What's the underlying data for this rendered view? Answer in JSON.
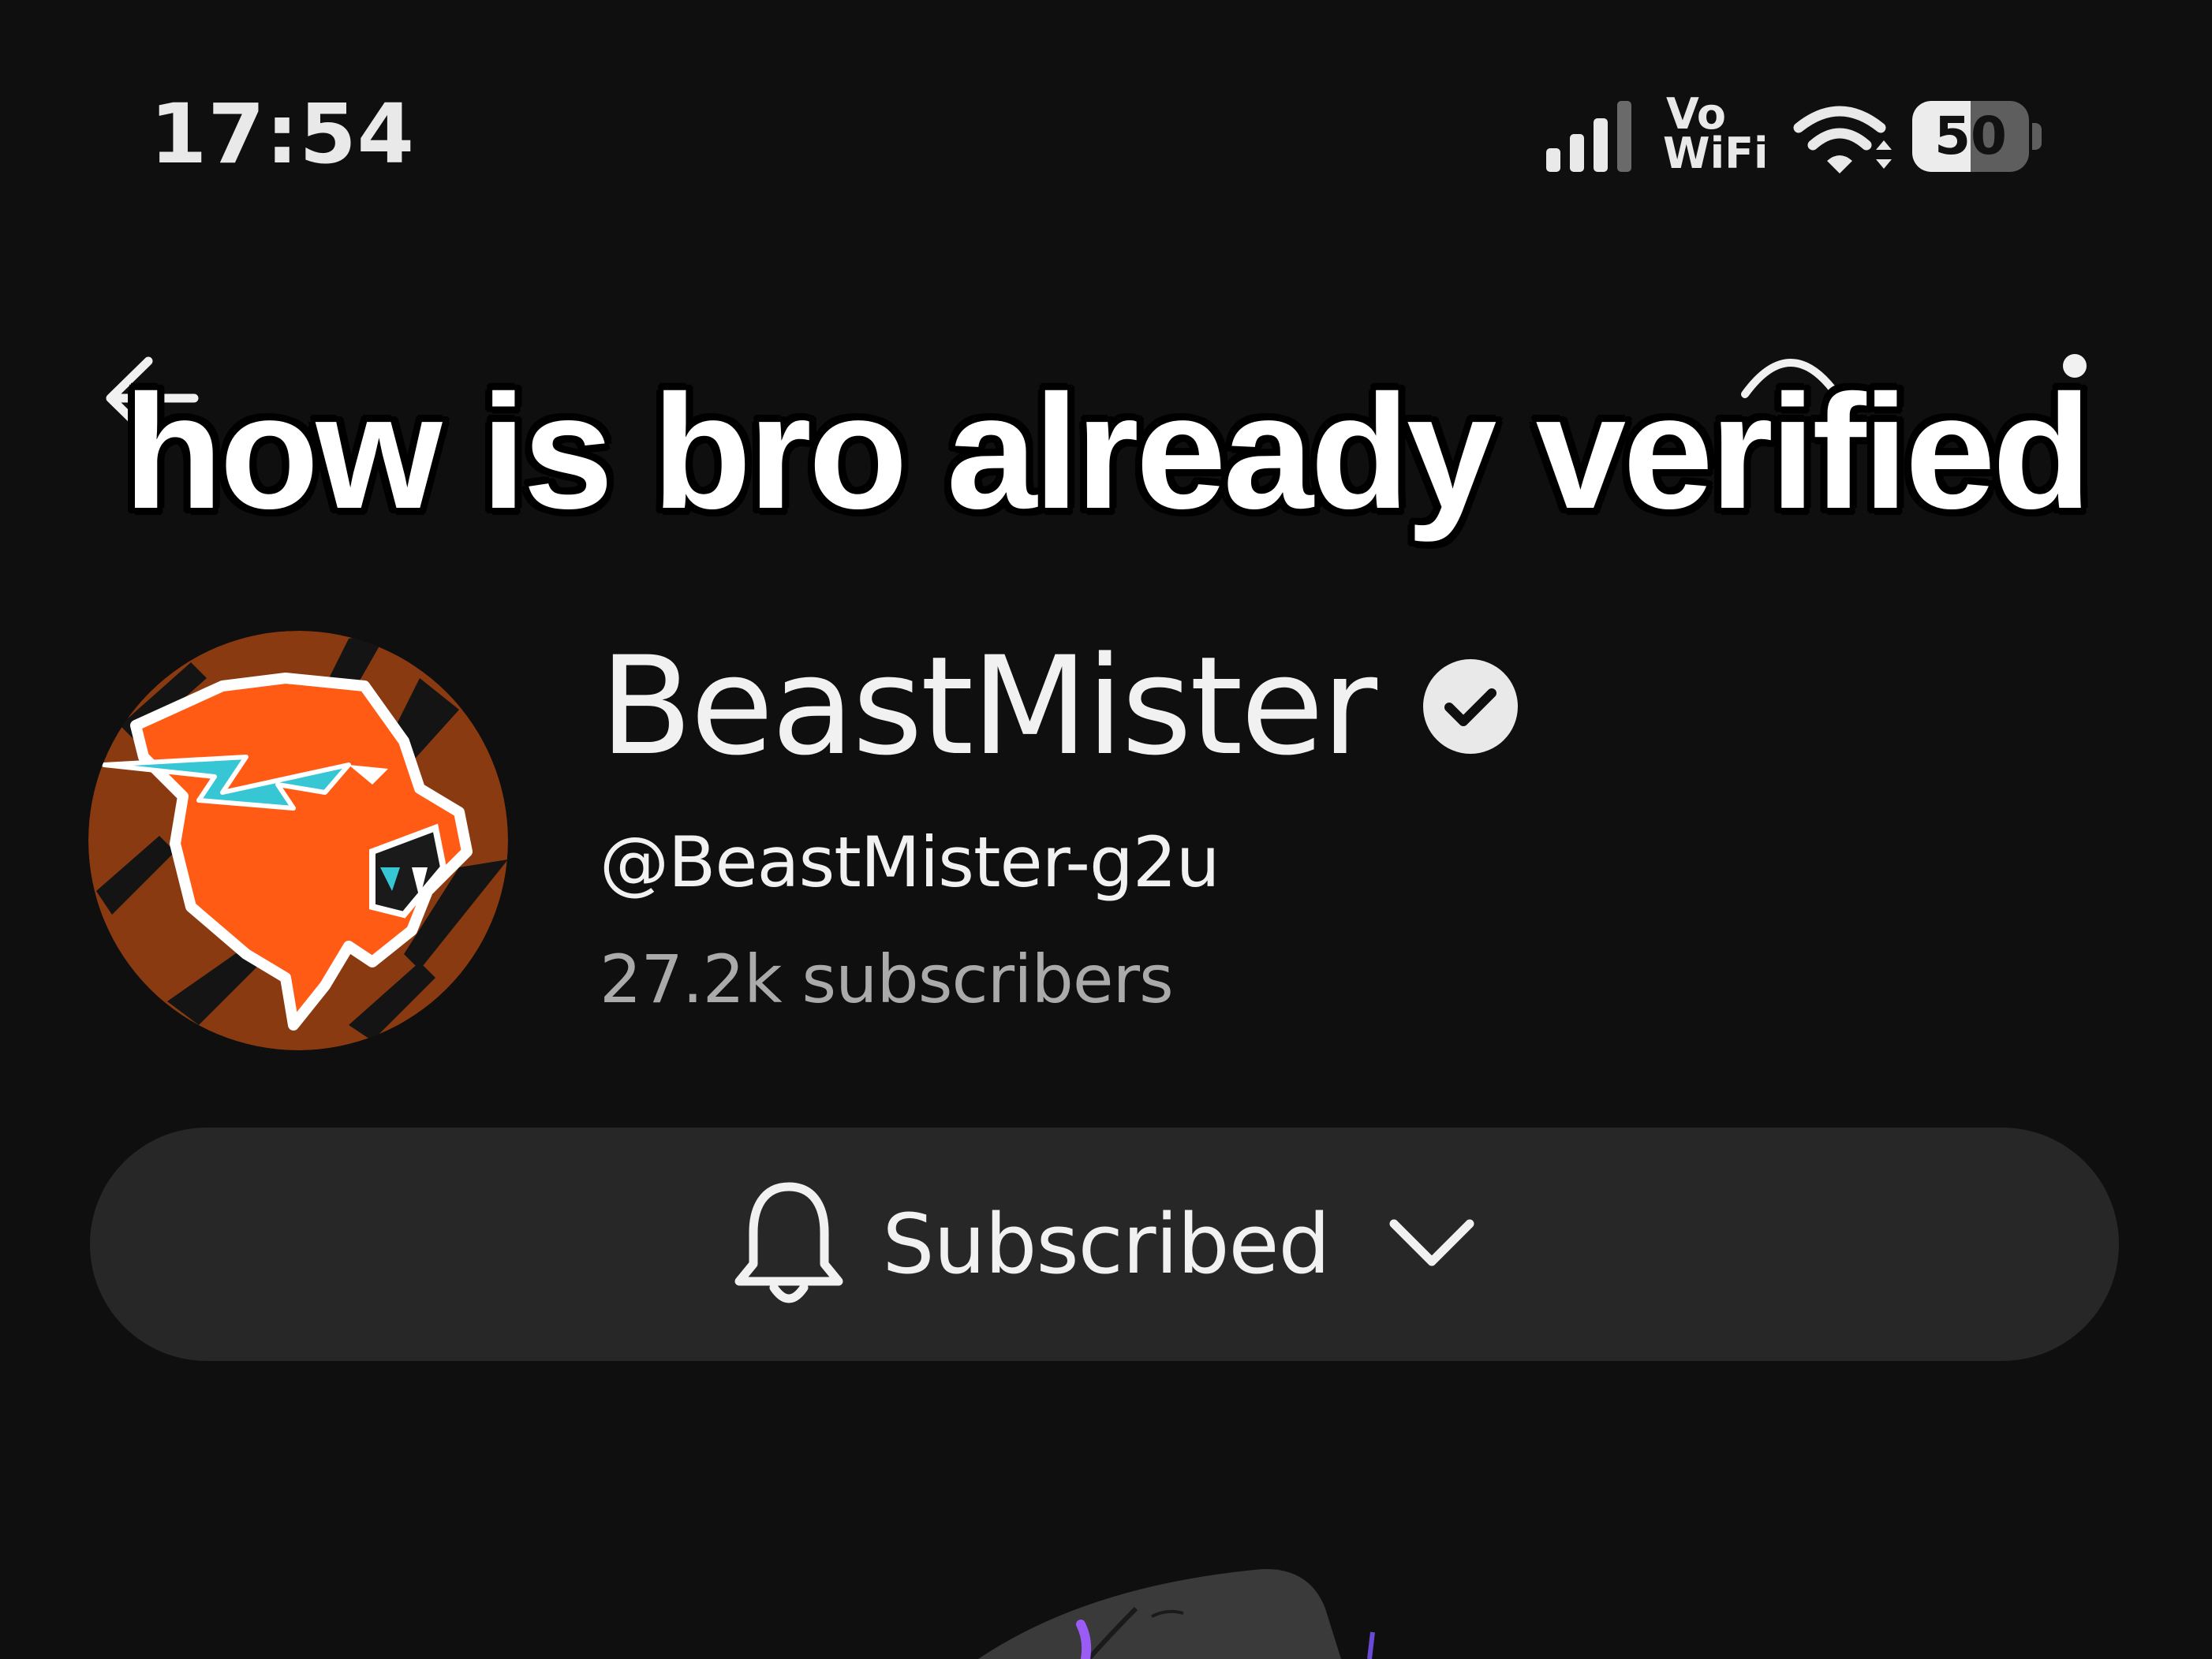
{
  "status_bar": {
    "time": "17:54",
    "vo": "Vo",
    "wifi_text": "WiFi",
    "battery": "50",
    "battery_fraction": 0.5
  },
  "top_bar": {
    "back_icon": "arrow-left-icon",
    "cast_icon": "cast-icon",
    "more_icon": "more-vertical-icon"
  },
  "caption": "how is bro already verified",
  "channel": {
    "name": "BeastMister",
    "verified_icon": "check-circle-icon",
    "handle": "@BeastMister-g2u",
    "subscribers": "27.2k subscribers"
  },
  "subscribe_button": {
    "label": "Subscribed",
    "icon": "bell-icon",
    "dropdown_icon": "chevron-down-icon"
  },
  "colors": {
    "background": "#0f0f0f",
    "button": "#272727",
    "text_primary": "#f1f1f1",
    "text_secondary": "#aaaaaa",
    "avatar_orange": "#ff5b14",
    "avatar_brown": "#8a3a10",
    "avatar_cyan": "#37c6d4"
  }
}
